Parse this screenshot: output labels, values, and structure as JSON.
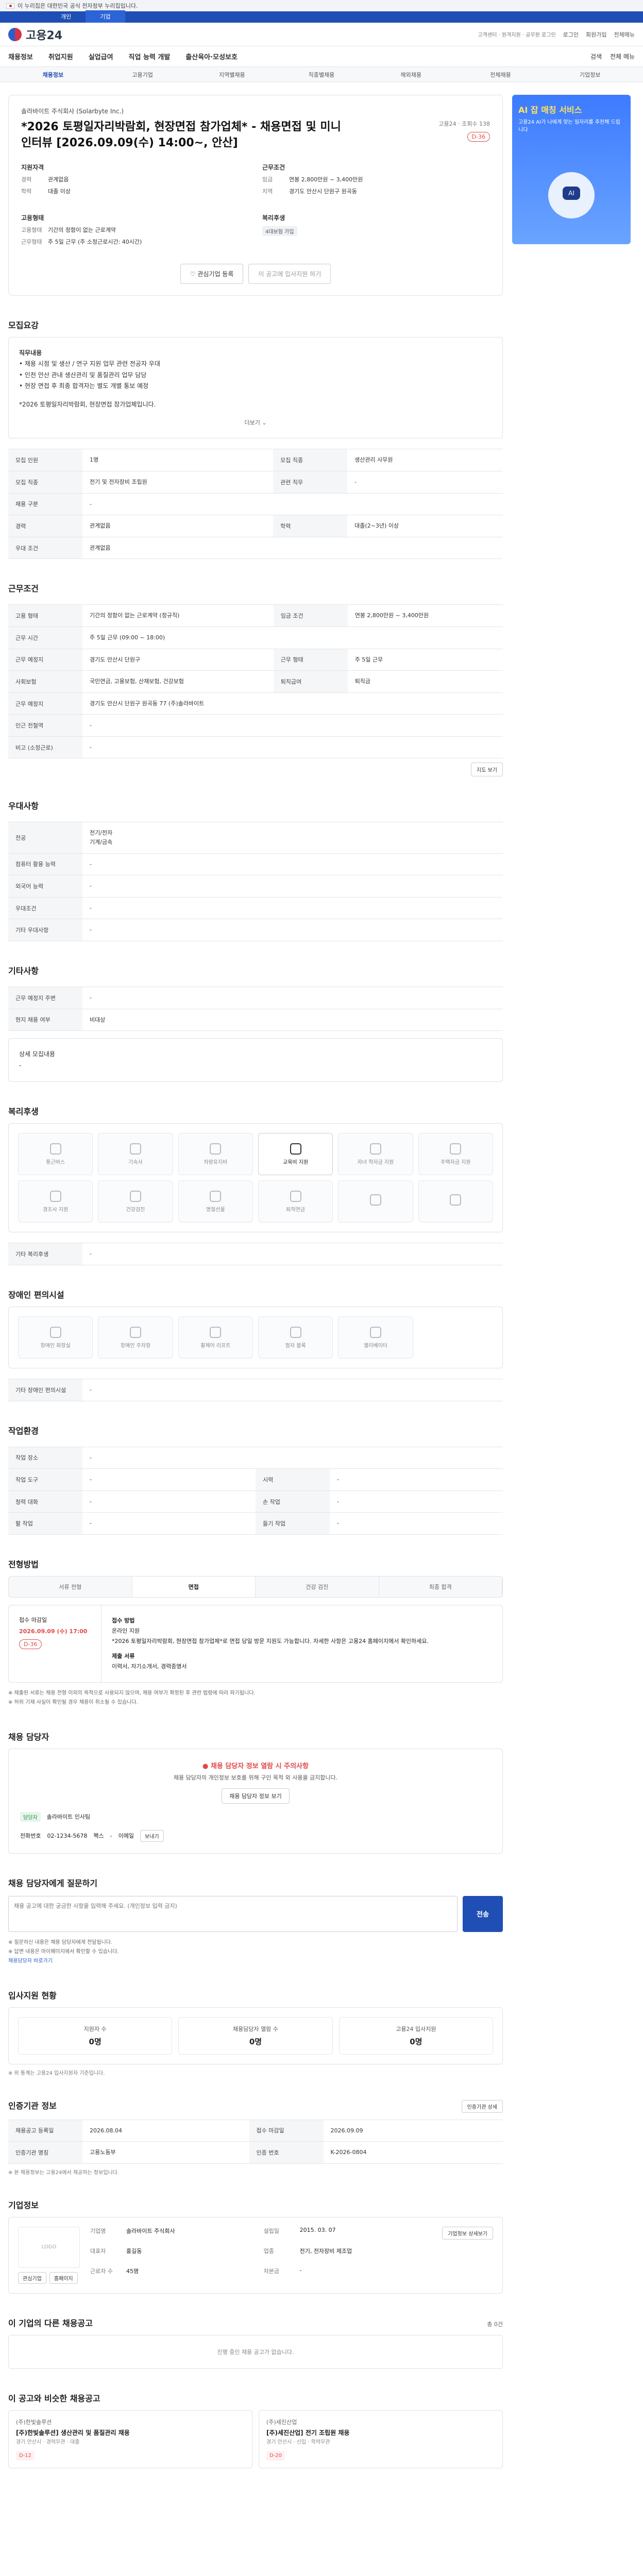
{
  "gov": {
    "text": "이 누리집은 대한민국 공식 전자정부 누리집입니다."
  },
  "topTabs": [
    "개인",
    "기업"
  ],
  "header": {
    "logo": "고용24",
    "links": [
      "로그인",
      "회원가입",
      "전체메뉴"
    ],
    "sub": "고객센터 · 원격지원 · 공무원 로그인"
  },
  "nav": {
    "items": [
      "채용정보",
      "취업지원",
      "실업급여",
      "직업 능력 개발",
      "출산육아·모성보호"
    ],
    "right": [
      "검색",
      "전체 메뉴"
    ]
  },
  "subnav": [
    "채용정보",
    "고용기업",
    "지역별채용",
    "직종별채용",
    "해외채용",
    "전체채용",
    "기업정보"
  ],
  "ad": {
    "title": "AI 잡 매칭 서비스",
    "desc": "고용24 AI가 나에게 맞는 일자리를 추천해 드립니다"
  },
  "job": {
    "company": "솔라바이트 주식회사 (Solarbyte Inc.)",
    "title": "*2026 토평일자리박람회, 현장면접 참가업체* - 채용면접 및 미니 인터뷰 [2026.09.09(수) 14:00~, 안산]",
    "side": "고용24 · 조회수 138",
    "dday": "D-36",
    "reqTitle": "지원자격",
    "reqRows": [
      [
        "경력",
        "관계없음"
      ],
      [
        "학력",
        "대졸 이상"
      ]
    ],
    "condTitle": "근무조건",
    "condRows": [
      [
        "임금",
        "연봉 2,800만원 ~ 3,400만원"
      ],
      [
        "지역",
        "경기도 안산시 단원구 원곡동"
      ]
    ],
    "typeTitle": "고용형태",
    "typeRows": [
      [
        "고용형태",
        "기간의 정함이 없는 근로계약"
      ],
      [
        "근무형태",
        "주 5일 근무 (주 소정근로시간: 40시간)"
      ]
    ],
    "welfareTitle": "복리후생",
    "welfareTag": "4대보험 가입",
    "btnScrap": "관심기업 등록",
    "btnApply": "이 공고에 입사지원 하기"
  },
  "duty": {
    "head": "모집요강",
    "label": "직무내용",
    "lines": [
      "• 채용 시점 및 생산 / 연구 지원 업무 관련 전공자 우대",
      "• 인천 안산 관내 생산관리 및 품질관리 업무 담당",
      "• 현장 면접 후 최종 합격자는 별도 개별 통보 예정"
    ],
    "extra": "*2026 토평일자리박람회, 현장면접 참가업체입니다.",
    "more": "더보기"
  },
  "recruit": {
    "rows": [
      [
        "모집 인원",
        "1명",
        "모집 직종",
        "생산관리 사무원"
      ],
      [
        "모집 직종",
        "전기 및 전자장비 조립원",
        "관련 직무",
        "-"
      ],
      [
        "채용 구분",
        "-",
        "",
        ""
      ],
      [
        "경력",
        "관계없음",
        "학력",
        "대졸(2~3년) 이상"
      ],
      [
        "우대 조건",
        "관계없음",
        "",
        ""
      ]
    ]
  },
  "cond": {
    "head": "근무조건",
    "rows": [
      [
        "고용 형태",
        "기간의 정함이 없는 근로계약 (정규직)",
        "임금 조건",
        "연봉 2,800만원 ~ 3,400만원"
      ],
      [
        "근무 시간",
        "주 5일 근무 (09:00 ~ 18:00)",
        "",
        ""
      ],
      [
        "근무 예정지",
        "경기도 안산시 단원구",
        "근무 형태",
        "주 5일 근무"
      ],
      [
        "사회보험",
        "국민연금, 고용보험, 산재보험, 건강보험",
        "퇴직급여",
        "퇴직금"
      ],
      [
        "근무 예정지",
        "경기도 안산시 단원구 원곡동 77 (주)솔라바이트",
        "",
        ""
      ],
      [
        "인근 전철역",
        "-",
        "",
        ""
      ],
      [
        "비고 (소정근로)",
        "-",
        "",
        ""
      ]
    ],
    "map": "지도 보기"
  },
  "pref": {
    "head": "우대사항",
    "rows": [
      [
        "전공",
        "전기/전자\n기계/금속"
      ],
      [
        "컴퓨터 활용 능력",
        "-"
      ],
      [
        "외국어 능력",
        "-"
      ],
      [
        "우대조건",
        "-"
      ],
      [
        "기타 우대사항",
        "-"
      ]
    ]
  },
  "etc": {
    "head": "기타사항",
    "rows": [
      [
        "근무 예정지 주변",
        "-"
      ],
      [
        "현지 채용 여부",
        "비대상"
      ]
    ],
    "more": "상세 모집내용"
  },
  "welfare": {
    "head": "복리후생",
    "items": [
      "통근버스",
      "기숙사",
      "차량유지비",
      "교육비 지원",
      "자녀 학자금 지원",
      "주택자금 지원",
      "경조사 지원",
      "건강검진",
      "명절선물",
      "퇴직연금",
      "",
      ""
    ],
    "onIndex": 3,
    "etcLabel": "기타 복리후생",
    "etcValue": "-"
  },
  "disability": {
    "head": "장애인 편의시설",
    "items": [
      "장애인 화장실",
      "장애인 주차장",
      "휠체어 리프트",
      "점자 블록",
      "엘리베이터"
    ],
    "etcLabel": "기타 장애인 편의시설",
    "etcValue": "-"
  },
  "workenv": {
    "head": "작업환경",
    "rows": [
      [
        "작업 장소",
        "-",
        "",
        ""
      ],
      [
        "작업 도구",
        "-",
        "시력",
        "-"
      ],
      [
        "청력 대화",
        "-",
        "손 작업",
        "-"
      ],
      [
        "팔 작업",
        "-",
        "들기 작업",
        "-"
      ]
    ]
  },
  "process": {
    "head": "전형방법",
    "steps": [
      "서류 전형",
      "면접",
      "건강 검진",
      "최종 합격"
    ],
    "activeIndex": 1,
    "deadLabel": "접수 마감일",
    "deadDate": "2026.09.09 (수) 17:00",
    "deadDday": "D-36",
    "methodLabel": "접수 방법",
    "method": "온라인 지원",
    "methodDesc": "*2026 토평일자리박람회, 현장면접 참가업체*로 면접 당일 방문 지원도 가능합니다. 자세한 사항은 고용24 홈페이지에서 확인하세요.",
    "docsLabel": "제출 서류",
    "docs": "이력서, 자기소개서, 경력증명서",
    "notes": [
      "※ 제출된 서류는 채용 전형 이외의 목적으로 사용되지 않으며, 채용 여부가 확정된 후 관련 법령에 따라 파기됩니다.",
      "※ 허위 기재 사실이 확인될 경우 채용이 취소될 수 있습니다."
    ]
  },
  "contact": {
    "head": "채용 담당자",
    "alert": "채용 담당자 정보 열람 시 주의사항",
    "alertSub": "채용 담당자의 개인정보 보호를 위해 구인 목적 외 사용을 금지합니다.",
    "btn": "채용 담당자 정보 보기",
    "tag": "담당자",
    "name": "솔라바이트 인사팀",
    "phoneLabel": "전화번호",
    "phone": "02-1234-5678",
    "fax": "팩스",
    "faxValue": "-",
    "email": "이메일",
    "emailBtn": "보내기"
  },
  "inquiry": {
    "head": "채용 담당자에게 질문하기",
    "placeholder": "채용 공고에 대한 궁금한 사항을 입력해 주세요. (개인정보 입력 금지)",
    "send": "전송",
    "notes": [
      "※ 질문하신 내용은 채용 담당자에게 전달됩니다.",
      "※ 답변 내용은 마이페이지에서 확인할 수 있습니다."
    ],
    "link": "채용담당자 바로가기"
  },
  "applicants": {
    "head": "입사지원 현황",
    "items": [
      [
        "지원자 수",
        "0명"
      ],
      [
        "채용담당자 열람 수",
        "0명"
      ],
      [
        "고용24 입사지원",
        "0명"
      ]
    ],
    "note": "※ 위 통계는 고용24 입사지원자 기준입니다."
  },
  "regInfo": {
    "head": "인증기관 정보",
    "btn": "인증기관 상세",
    "rows": [
      [
        "채용공고 등록일",
        "2026.08.04",
        "접수 마감일",
        "2026.09.09"
      ],
      [
        "인증기관 명칭",
        "고용노동부",
        "인증 번호",
        "K-2026-0804"
      ]
    ],
    "note": "※ 본 채용정보는 고용24에서 제공하는 정보입니다."
  },
  "org": {
    "head": "기업정보",
    "logo": "LOGO",
    "rows": [
      [
        "기업명",
        "솔라바이트 주식회사",
        "설립일",
        "2015. 03. 07"
      ],
      [
        "대표자",
        "홍길동",
        "업종",
        "전기, 전자장비 제조업"
      ],
      [
        "근로자 수",
        "45명",
        "자본금",
        "-"
      ]
    ],
    "btns": [
      "관심기업",
      "홈페이지"
    ],
    "detail": "기업정보 상세보기"
  },
  "similar": {
    "head": "이 기업의 다른 채용공고",
    "small": "총 0건",
    "empty": "진행 중인 채용 공고가 없습니다."
  },
  "recommend": {
    "head": "이 공고와 비슷한 채용공고",
    "items": [
      {
        "co": "(주)한빛솔루션",
        "title": "[주)한빛솔루션] 생산관리 및 품질관리 채용",
        "meta": "경기 안산시 · 경력무관 · 대졸",
        "chip": "D-12"
      },
      {
        "co": "(주)세진산업",
        "title": "[주)세진산업] 전기 조립원 채용",
        "meta": "경기 안산시 · 신입 · 학력무관",
        "chip": "D-20"
      }
    ]
  }
}
